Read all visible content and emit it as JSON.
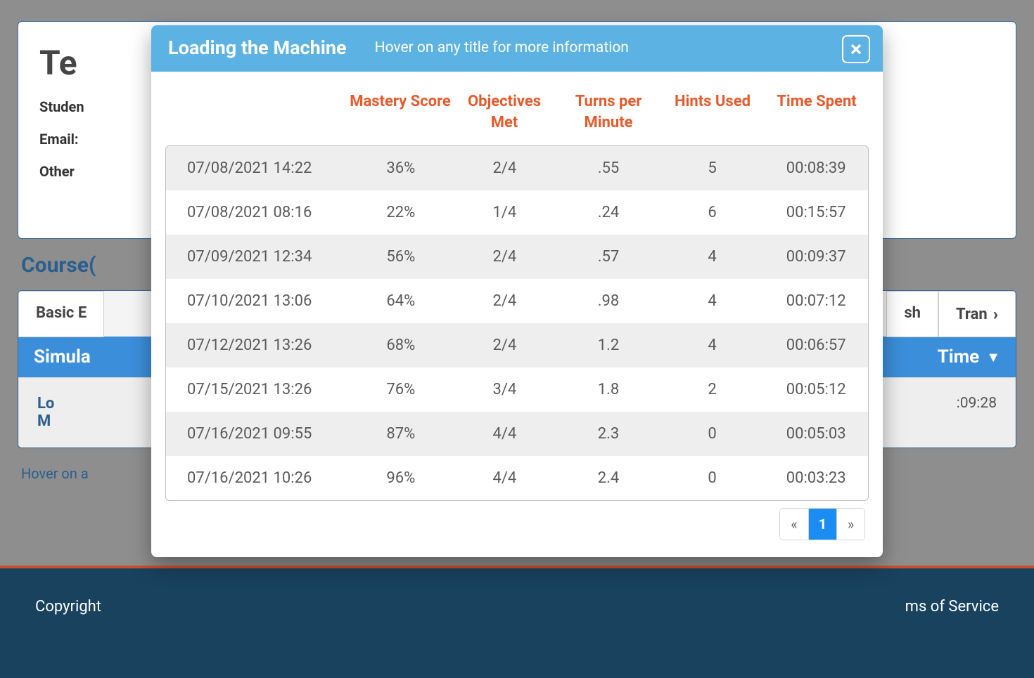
{
  "bg": {
    "title_fragment": "Te",
    "field_student": "Studen",
    "field_email": "Email:",
    "field_other": "Other",
    "courses_label": "Course(",
    "tab_basic": "Basic E",
    "tab_sh": "sh",
    "tab_tran": "Tran",
    "blue_left": "Simula",
    "blue_right": "Time",
    "sub_left_line1": "Lo",
    "sub_left_line2": "M",
    "sub_time": ":09:28",
    "hint": "Hover on a",
    "footer_left": "Copyright",
    "footer_right": "ms of Service"
  },
  "modal": {
    "title": "Loading the Machine",
    "subtitle": "Hover on any title for more information",
    "headers": {
      "mastery": "Mastery Score",
      "objectives": "Objectives Met",
      "tpm": "Turns per Minute",
      "hints": "Hints Used",
      "time": "Time Spent"
    },
    "rows": [
      {
        "ts": "07/08/2021 14:22",
        "mastery": "36%",
        "obj": "2/4",
        "tpm": ".55",
        "hints": "5",
        "time": "00:08:39"
      },
      {
        "ts": "07/08/2021 08:16",
        "mastery": "22%",
        "obj": "1/4",
        "tpm": ".24",
        "hints": "6",
        "time": "00:15:57"
      },
      {
        "ts": "07/09/2021 12:34",
        "mastery": "56%",
        "obj": "2/4",
        "tpm": ".57",
        "hints": "4",
        "time": "00:09:37"
      },
      {
        "ts": "07/10/2021 13:06",
        "mastery": "64%",
        "obj": "2/4",
        "tpm": ".98",
        "hints": "4",
        "time": "00:07:12"
      },
      {
        "ts": "07/12/2021 13:26",
        "mastery": "68%",
        "obj": "2/4",
        "tpm": "1.2",
        "hints": "4",
        "time": "00:06:57"
      },
      {
        "ts": "07/15/2021 13:26",
        "mastery": "76%",
        "obj": "3/4",
        "tpm": "1.8",
        "hints": "2",
        "time": "00:05:12"
      },
      {
        "ts": "07/16/2021 09:55",
        "mastery": "87%",
        "obj": "4/4",
        "tpm": "2.3",
        "hints": "0",
        "time": "00:05:03"
      },
      {
        "ts": "07/16/2021 10:26",
        "mastery": "96%",
        "obj": "4/4",
        "tpm": "2.4",
        "hints": "0",
        "time": "00:03:23"
      }
    ],
    "pager": {
      "prev": "«",
      "next": "»",
      "page": "1"
    }
  }
}
